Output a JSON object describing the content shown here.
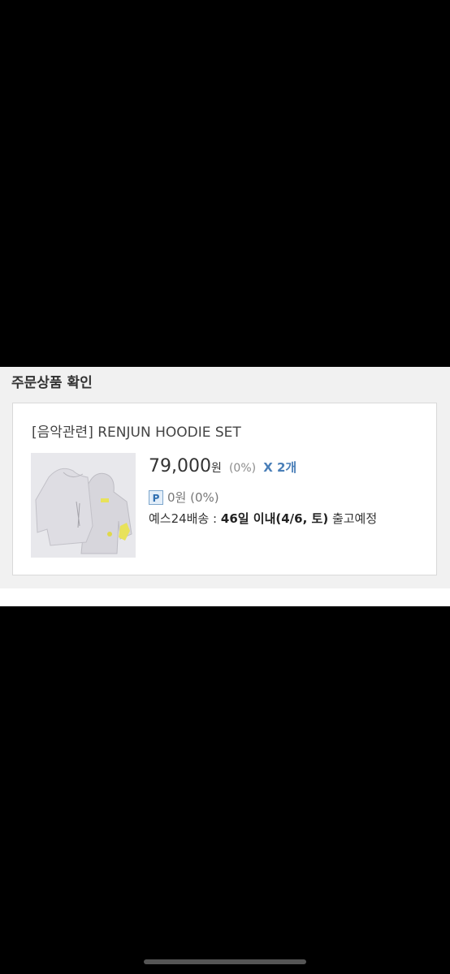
{
  "section": {
    "title": "주문상품 확인"
  },
  "product": {
    "name": "[음악관련] RENJUN HOODIE SET",
    "image_alt": "RENJUN HOODIE SET",
    "price": "79,000",
    "currency": "원",
    "discount": "(0%)",
    "quantity": "X 2개",
    "points_badge": "P",
    "points": "0원 (0%)",
    "delivery_method": "예스24배송 : ",
    "delivery_eta": "46일 이내(4/6, 토)",
    "delivery_suffix": " 출고예정"
  }
}
